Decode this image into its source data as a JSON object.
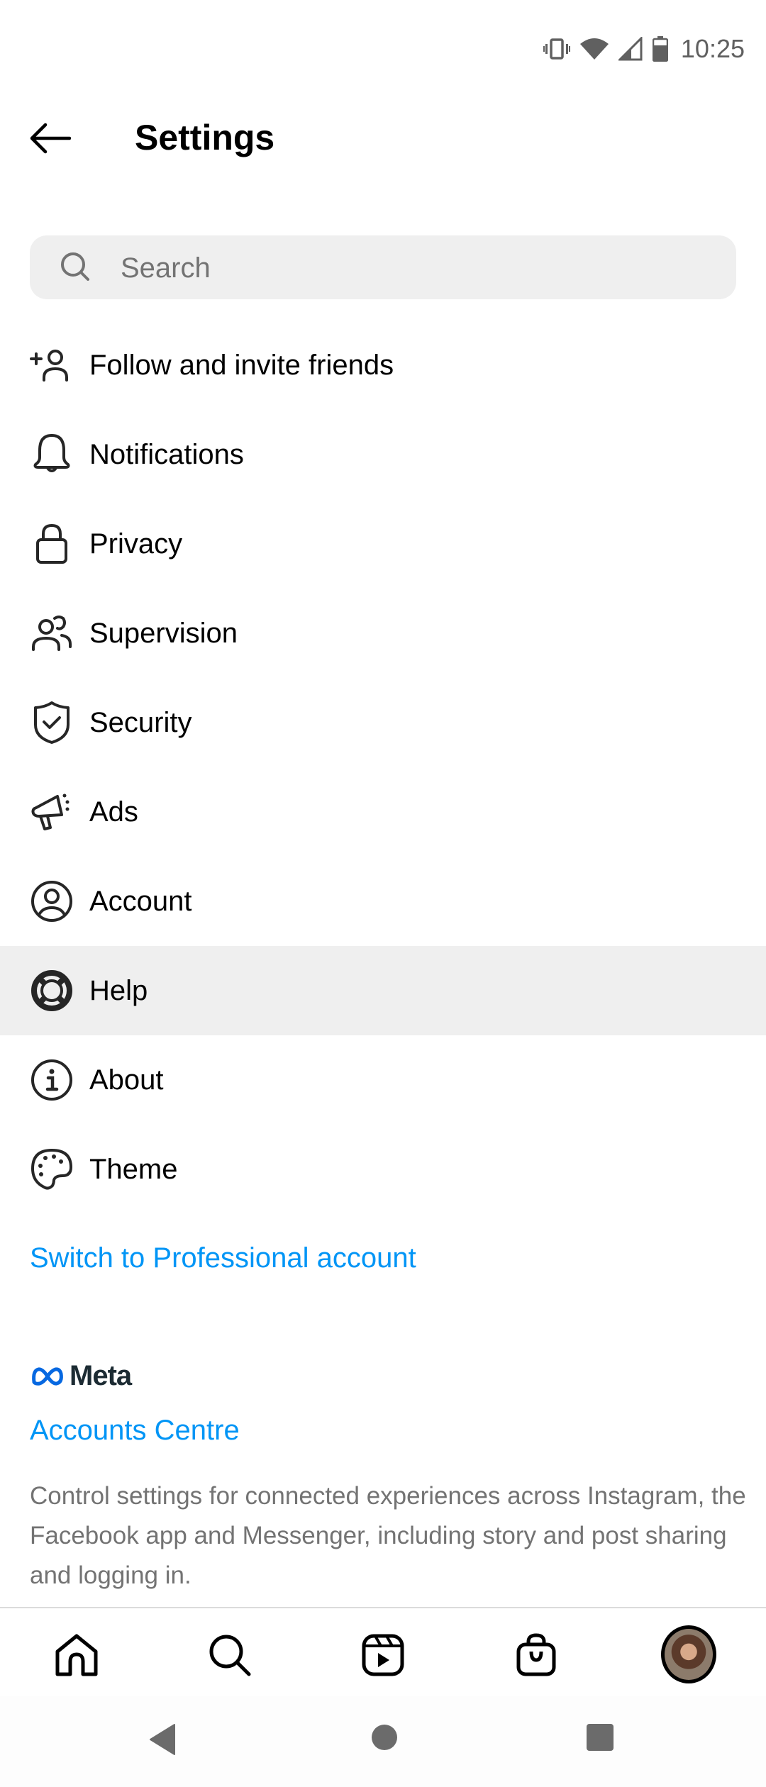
{
  "status_bar": {
    "time": "10:25",
    "icons": [
      "vibrate-icon",
      "wifi-icon",
      "signal-icon",
      "battery-icon"
    ]
  },
  "header": {
    "back_icon": "arrow-left-icon",
    "title": "Settings"
  },
  "search": {
    "placeholder": "Search",
    "value": "",
    "icon": "search-icon"
  },
  "menu": {
    "items": [
      {
        "label": "Follow and invite friends",
        "icon": "add-person-icon",
        "highlighted": false
      },
      {
        "label": "Notifications",
        "icon": "bell-icon",
        "highlighted": false
      },
      {
        "label": "Privacy",
        "icon": "lock-icon",
        "highlighted": false
      },
      {
        "label": "Supervision",
        "icon": "people-icon",
        "highlighted": false
      },
      {
        "label": "Security",
        "icon": "shield-check-icon",
        "highlighted": false
      },
      {
        "label": "Ads",
        "icon": "megaphone-icon",
        "highlighted": false
      },
      {
        "label": "Account",
        "icon": "account-circle-icon",
        "highlighted": false
      },
      {
        "label": "Help",
        "icon": "lifebuoy-icon",
        "highlighted": true
      },
      {
        "label": "About",
        "icon": "info-icon",
        "highlighted": false
      },
      {
        "label": "Theme",
        "icon": "palette-icon",
        "highlighted": false
      }
    ]
  },
  "professional_link": "Switch to Professional account",
  "meta_section": {
    "logo_text": "Meta",
    "accounts_centre": "Accounts Centre",
    "description": "Control settings for connected experiences across Instagram, the Facebook app and Messenger, including story and post sharing and logging in."
  },
  "bottom_nav": {
    "items": [
      "home-icon",
      "search-icon",
      "reels-icon",
      "shop-icon",
      "profile-avatar"
    ]
  },
  "system_nav": {
    "items": [
      "back-triangle-icon",
      "home-circle-icon",
      "recents-square-icon"
    ]
  },
  "colors": {
    "link_blue": "#0095f6",
    "highlight_bg": "#efefef",
    "secondary_text": "#737373",
    "meta_blue": "#0668e1"
  }
}
